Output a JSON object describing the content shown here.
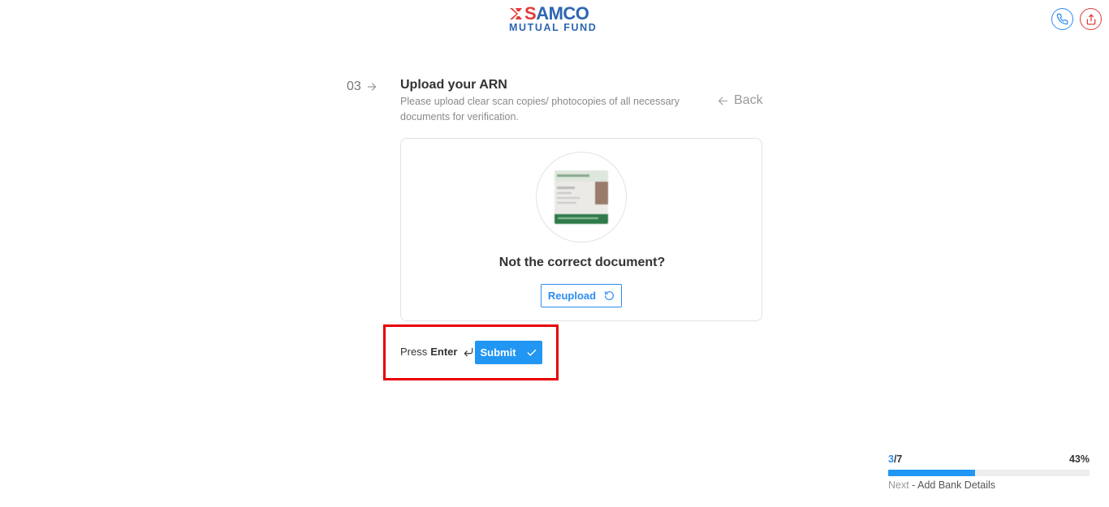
{
  "brand": {
    "logo_top": "SAMCO",
    "logo_top_first": "S",
    "logo_top_rest": "AMCO",
    "logo_bottom": "MUTUAL FUND",
    "red": "#e23b3b",
    "blue": "#2d66b2"
  },
  "header_icons": {
    "call_icon": "phone-icon",
    "share_icon": "share-icon"
  },
  "step": {
    "number": "03",
    "title": "Upload your ARN",
    "description": "Please upload clear scan copies/ photocopies of all necessary documents for verification.",
    "back_label": "Back"
  },
  "upload_card": {
    "question": "Not the correct document?",
    "reupload_label": "Reupload"
  },
  "submit_area": {
    "press_text": "Press",
    "enter_text": "Enter",
    "submit_label": "Submit"
  },
  "progress": {
    "current": "3",
    "total": "/7",
    "percent_label": "43%",
    "fraction": 0.43,
    "next_label": "Next",
    "next_separator": " - ",
    "next_step": "Add Bank Details"
  },
  "colors": {
    "accent": "#2196f3",
    "highlight": "#e60000"
  }
}
